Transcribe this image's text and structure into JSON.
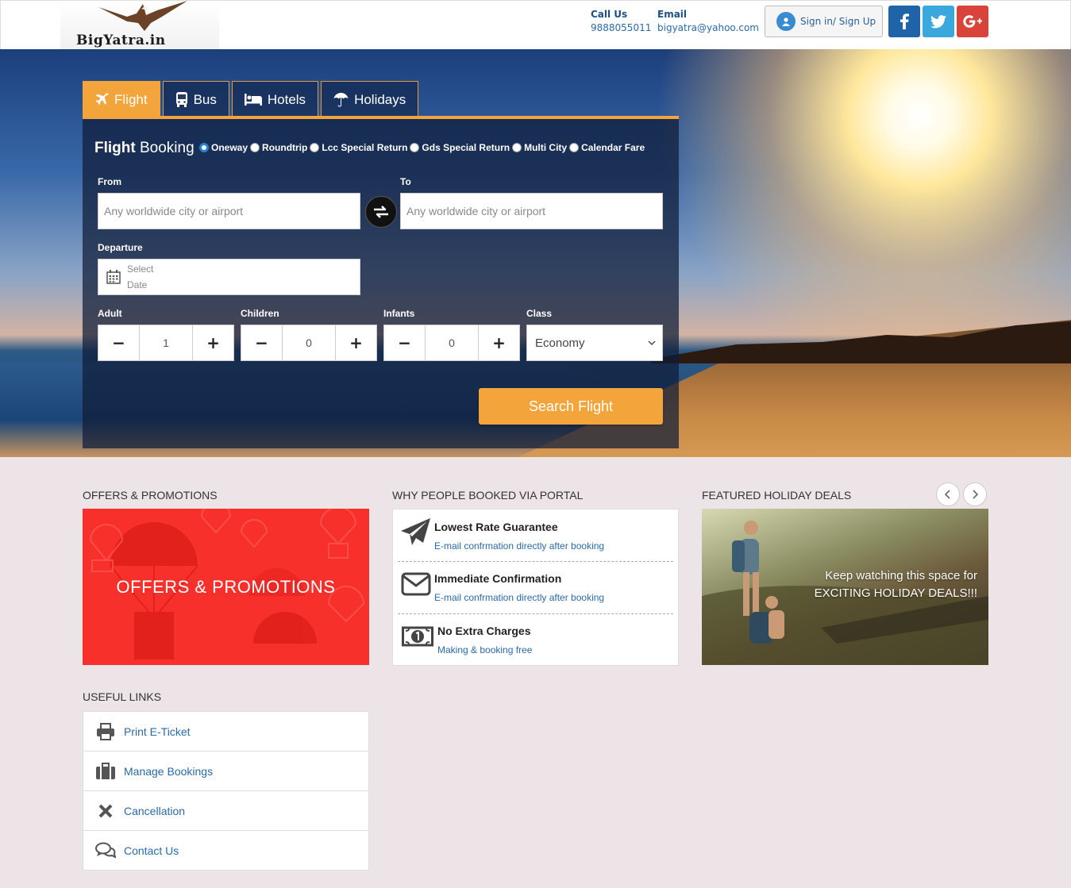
{
  "header": {
    "brand": "BigYatra.in",
    "call_label": "Call Us",
    "call_value": "9888055011",
    "email_label": "Email",
    "email_value": "bigyatra@yahoo.com",
    "signin_label": "Sign in/ Sign Up",
    "social": [
      {
        "name": "facebook",
        "glyph": "f",
        "color": "#1f64a8"
      },
      {
        "name": "twitter",
        "glyph": "t",
        "color": "#3aa7dd"
      },
      {
        "name": "google-plus",
        "glyph": "g+",
        "color": "#d9433a"
      }
    ]
  },
  "tabs": [
    {
      "label": "Flight",
      "icon": "plane-icon",
      "active": true
    },
    {
      "label": "Bus",
      "icon": "bus-icon",
      "active": false
    },
    {
      "label": "Hotels",
      "icon": "bed-icon",
      "active": false
    },
    {
      "label": "Holidays",
      "icon": "umbrella-icon",
      "active": false
    }
  ],
  "booking": {
    "title_bold": "Flight",
    "title_rest": "Booking",
    "trip_types": [
      "Oneway",
      "Roundtrip",
      "Lcc Special Return",
      "Gds Special Return",
      "Multi City",
      "Calendar Fare"
    ],
    "selected_trip_type": "Oneway",
    "from_label": "From",
    "from_placeholder": "Any worldwide city or airport",
    "to_label": "To",
    "to_placeholder": "Any worldwide city or airport",
    "departure_label": "Departure",
    "departure_placeholder_line1": "Select",
    "departure_placeholder_line2": "Date",
    "adult_label": "Adult",
    "adult_value": "1",
    "children_label": "Children",
    "children_value": "0",
    "infants_label": "Infants",
    "infants_value": "0",
    "class_label": "Class",
    "class_value": "Economy",
    "search_label": "Search Flight"
  },
  "offers": {
    "heading": "OFFERS & PROMOTIONS",
    "banner_text": "OFFERS & PROMOTIONS"
  },
  "why": {
    "heading": "WHY PEOPLE BOOKED VIA PORTAL",
    "items": [
      {
        "title": "Lowest Rate Guarantee",
        "subtitle": "E-mail confrmation directly after booking",
        "icon": "paper-plane-icon"
      },
      {
        "title": "Immediate Confirmation",
        "subtitle": "E-mail confrmation directly after booking",
        "icon": "envelope-icon"
      },
      {
        "title": "No Extra Charges",
        "subtitle": "Making & booking free",
        "icon": "money-icon"
      }
    ]
  },
  "deals": {
    "heading": "FEATURED HOLIDAY DEALS",
    "line1": "Keep watching this space for",
    "line2": "EXCITING HOLIDAY DEALS!!!"
  },
  "useful_links": {
    "heading": "USEFUL LINKS",
    "items": [
      {
        "label": "Print E-Ticket",
        "icon": "printer-icon"
      },
      {
        "label": "Manage Bookings",
        "icon": "briefcase-icon"
      },
      {
        "label": "Cancellation",
        "icon": "cross-icon"
      },
      {
        "label": "Contact Us",
        "icon": "chat-icon"
      }
    ]
  }
}
